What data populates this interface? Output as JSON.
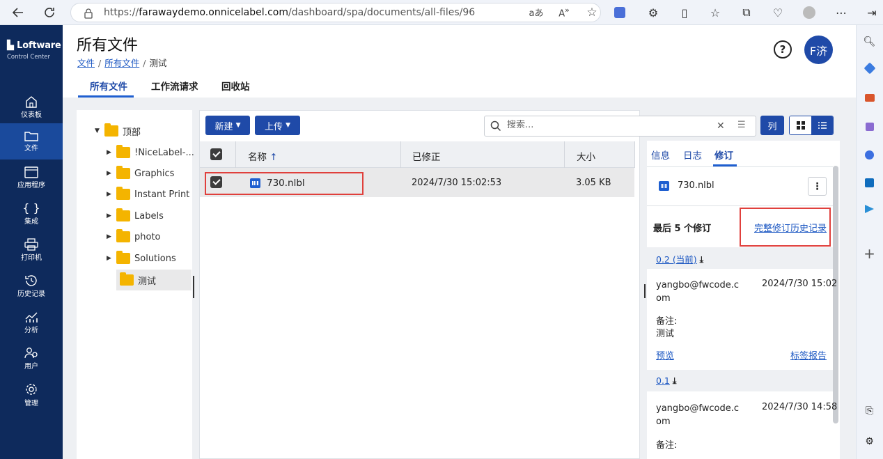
{
  "browser": {
    "url_prefix": "https://",
    "url_domain": "farawaydemo.onnicelabel.com",
    "url_path": "/dashboard/spa/documents/all-files/96"
  },
  "brand": {
    "logo": "Loftware",
    "sub": "Control Center"
  },
  "nav": [
    {
      "label": "仪表板",
      "icon": "home-icon"
    },
    {
      "label": "文件",
      "icon": "folder-icon"
    },
    {
      "label": "应用程序",
      "icon": "app-window-icon"
    },
    {
      "label": "集成",
      "icon": "braces-icon"
    },
    {
      "label": "打印机",
      "icon": "printer-icon"
    },
    {
      "label": "历史记录",
      "icon": "history-icon"
    },
    {
      "label": "分析",
      "icon": "chart-icon"
    },
    {
      "label": "用户",
      "icon": "users-icon"
    },
    {
      "label": "管理",
      "icon": "gear-icon"
    }
  ],
  "header": {
    "title": "所有文件",
    "breadcrumb": [
      "文件",
      "所有文件",
      "测试"
    ],
    "avatar": "F济",
    "help": "?"
  },
  "tabs": [
    "所有文件",
    "工作流请求",
    "回收站"
  ],
  "tree": {
    "root": "顶部",
    "folders": [
      "!NiceLabel-...",
      "Graphics",
      "Instant Print",
      "Labels",
      "photo",
      "Solutions",
      "测试"
    ]
  },
  "toolbar": {
    "new_label": "新建",
    "upload_label": "上传",
    "search_placeholder": "搜索...",
    "columns_label": "列"
  },
  "table": {
    "headers": [
      "名称",
      "已修正",
      "大小"
    ],
    "sort_arrow": "↑",
    "rows": [
      {
        "name": "730.nlbl",
        "modified": "2024/7/30 15:02:53",
        "size": "3.05 KB"
      }
    ]
  },
  "details": {
    "tabs": [
      "信息",
      "日志",
      "修订"
    ],
    "file_name": "730.nlbl",
    "last_revisions_label": "最后 5 个修订",
    "full_history_link": "完整修订历史记录",
    "revisions": [
      {
        "version": "0.2 (当前)",
        "user": "yangbo@fwcode.c\nom",
        "date": "2024/7/30 15:02",
        "note_label": "备注:",
        "note": "测试",
        "preview": "预览",
        "report": "标签报告"
      },
      {
        "version": "0.1",
        "user": "yangbo@fwcode.c\nom",
        "date": "2024/7/30 14:58",
        "note_label": "备注:"
      }
    ]
  },
  "colors": {
    "nav_bg": "#0e2a5c",
    "nav_active": "#1a4a9c",
    "accent": "#1f4aa8",
    "highlight": "#e0403c"
  }
}
